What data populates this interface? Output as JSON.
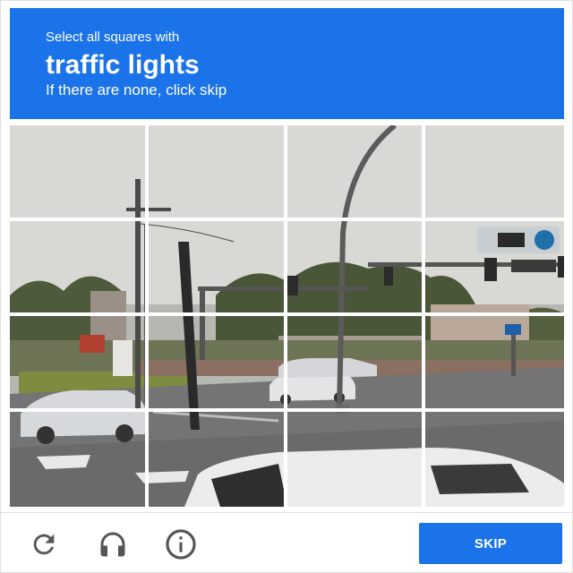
{
  "header": {
    "instruction": "Select all squares with",
    "target": "traffic lights",
    "hint": "If there are none, click skip"
  },
  "grid": {
    "rows": 4,
    "cols": 4
  },
  "footer": {
    "reload_icon": "reload-icon",
    "audio_icon": "headphones-icon",
    "info_icon": "info-icon",
    "skip_label": "SKIP"
  },
  "colors": {
    "accent": "#1a73e8",
    "header_text": "#ffffff",
    "icon": "#555555"
  }
}
